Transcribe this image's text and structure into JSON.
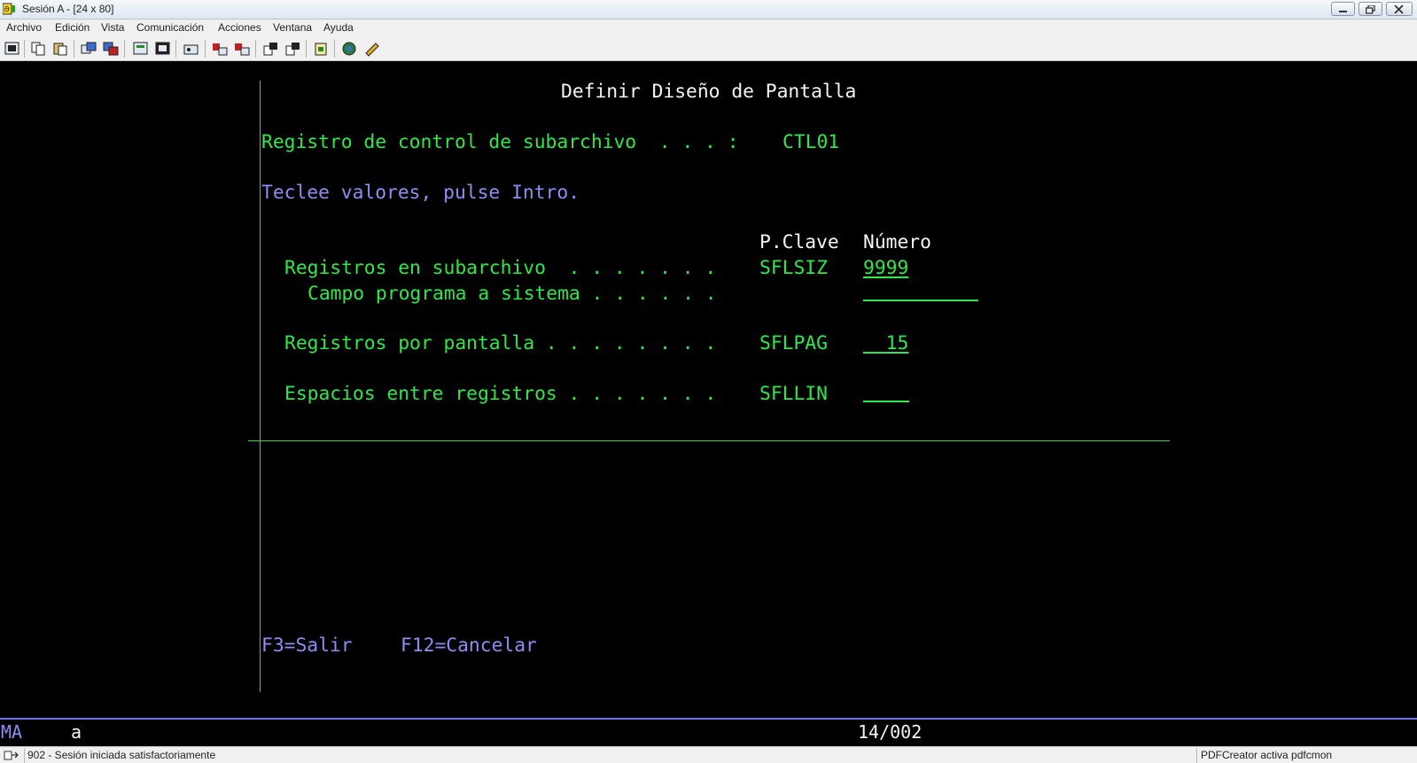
{
  "window": {
    "title": "Sesión A - [24 x 80]"
  },
  "menu": [
    {
      "label": "Archivo"
    },
    {
      "label": "Edición"
    },
    {
      "label": "Vista"
    },
    {
      "label": "Comunicación"
    },
    {
      "label": "Acciones"
    },
    {
      "label": "Ventana"
    },
    {
      "label": "Ayuda"
    }
  ],
  "toolbar": {
    "buttons": [
      "print-screen",
      "copy",
      "paste",
      "send-file",
      "receive-file",
      "display-macro",
      "keyboard-map",
      "record-macro",
      "stop-macro",
      "play-macro",
      "run-script",
      "sessions",
      "customize-keyboard",
      "help",
      "edit-properties",
      "erase"
    ]
  },
  "screen": {
    "title": "Definir Diseño de Pantalla",
    "control_label": "Registro de control de subarchivo  . . . :",
    "control_value": "CTL01",
    "instructions": "Teclee valores, pulse Intro.",
    "col_keyword": "P.Clave",
    "col_number": "Número",
    "rows": [
      {
        "label": "Registros en subarchivo  . . . . . . .",
        "keyword": "SFLSIZ",
        "value": "9999"
      },
      {
        "label": "Campo programa a sistema . . . . . .",
        "keyword": "",
        "value": ""
      },
      {
        "label": "Registros por pantalla . . . . . . . .",
        "keyword": "SFLPAG",
        "value": "  15"
      },
      {
        "label": "Espacios entre registros . . . . . . .",
        "keyword": "SFLLIN",
        "value": ""
      }
    ],
    "function_keys": [
      {
        "label": "F3=Salir"
      },
      {
        "label": "F12=Cancelar"
      }
    ]
  },
  "oia": {
    "indicator": "MA",
    "mode": "a",
    "cursor_position": "14/002"
  },
  "status": {
    "left": "902 - Sesión iniciada satisfactoriamente",
    "right": "PDFCreator activa pdfcmon"
  }
}
